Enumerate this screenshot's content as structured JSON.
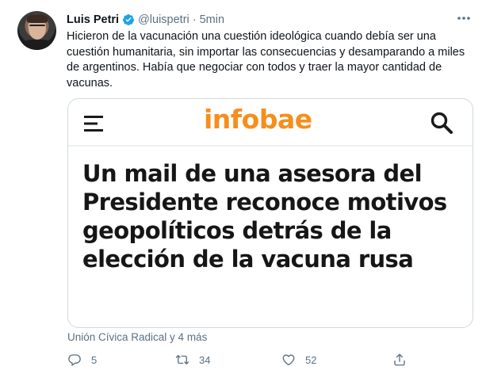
{
  "tweet": {
    "author_name": "Luis Petri",
    "handle": "@luispetri",
    "separator": "·",
    "time": "5min",
    "text": "Hicieron de la vacunación una cuestión ideológica cuando debía ser una cuestión humanitaria, sin importar las consecuencias y desamparando a miles de argentinos. Había que negociar con todos y traer la mayor cantidad de vacunas.",
    "source": "Unión Cívica Radical y 4 más",
    "icons": {
      "verified": "verified-badge-icon",
      "more": "more-options-icon",
      "reply": "reply-icon",
      "retweet": "retweet-icon",
      "like": "like-icon",
      "share": "share-icon"
    },
    "counts": {
      "replies": "5",
      "retweets": "34",
      "likes": "52"
    }
  },
  "card": {
    "logo_text": "infobae",
    "headline": "Un mail de una asesora del Presidente reconoce motivos geopolíticos detrás de la elección de la vacuna rusa",
    "icons": {
      "menu": "hamburger-menu-icon",
      "search": "search-icon"
    }
  },
  "colors": {
    "text_primary": "#0f1419",
    "text_secondary": "#5b7083",
    "verified_blue": "#1da1f2",
    "brand_orange": "#f68e1e",
    "border": "#cfd9de"
  }
}
